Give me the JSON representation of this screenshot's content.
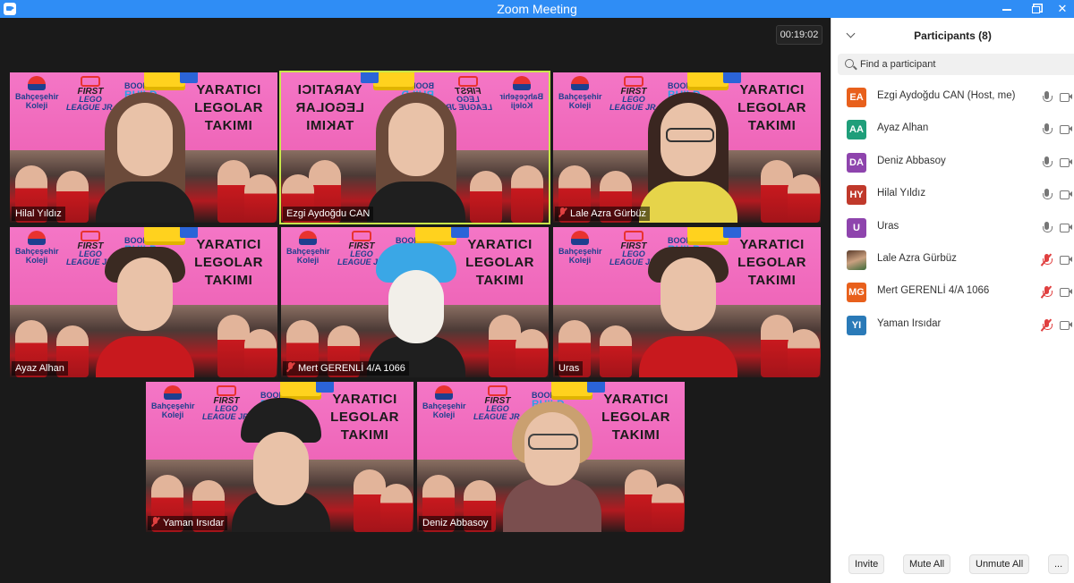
{
  "window": {
    "title": "Zoom Meeting"
  },
  "meeting": {
    "timer": "00:19:02",
    "banner": {
      "school_line1": "Bahçeşehir",
      "school_line2": "Koleji",
      "fll_first": "FIRST",
      "fll_lego": "LEGO",
      "fll_league": "LEAGUE JR.",
      "boomtown": "BOOMTOWN",
      "build": "BUILD",
      "slogan1": "YARATICI",
      "slogan2": "LEGOLAR",
      "slogan3": "TAKIMI"
    },
    "tiles": [
      {
        "name": "Hilal Yıldız",
        "muted": false,
        "active": false,
        "style": "p-light"
      },
      {
        "name": "Ezgi Aydoğdu CAN",
        "muted": false,
        "active": true,
        "style": "p-light"
      },
      {
        "name": "Lale Azra Gürbüz",
        "muted": true,
        "active": false,
        "style": "p-glasses p-scarf"
      },
      {
        "name": "Ayaz Alhan",
        "muted": false,
        "active": false,
        "style": "p-kid"
      },
      {
        "name": "Mert GERENLİ 4/A 1066",
        "muted": true,
        "active": false,
        "style": "p-blue"
      },
      {
        "name": "Uras",
        "muted": false,
        "active": false,
        "style": "p-kid"
      },
      {
        "name": "Yaman Irsıdar ",
        "muted": true,
        "active": false,
        "style": "p-hat"
      },
      {
        "name": "Deniz Abbasoy",
        "muted": false,
        "active": false,
        "style": "p-sweater"
      }
    ]
  },
  "participants": {
    "title": "Participants (8)",
    "search_placeholder": "Find a participant",
    "list": [
      {
        "initials": "EA",
        "color": "#e8601c",
        "name": "Ezgi Aydoğdu CAN (Host, me)",
        "muted": false
      },
      {
        "initials": "AA",
        "color": "#1f9e7a",
        "name": "Ayaz Alhan",
        "muted": false
      },
      {
        "initials": "DA",
        "color": "#8e44ad",
        "name": "Deniz Abbasoy",
        "muted": false
      },
      {
        "initials": "HY",
        "color": "#c0392b",
        "name": "Hilal Yıldız",
        "muted": false
      },
      {
        "initials": "U",
        "color": "#8e44ad",
        "name": "Uras",
        "muted": false
      },
      {
        "initials": "",
        "color": "",
        "name": "Lale Azra Gürbüz",
        "muted": true
      },
      {
        "initials": "MG",
        "color": "#e8601c",
        "name": "Mert GERENLİ 4/A 1066",
        "muted": true
      },
      {
        "initials": "YI",
        "color": "#2a7ab8",
        "name": "Yaman Irsıdar ",
        "muted": true
      }
    ],
    "buttons": {
      "invite": "Invite",
      "mute_all": "Mute All",
      "unmute_all": "Unmute All",
      "more": "..."
    }
  }
}
